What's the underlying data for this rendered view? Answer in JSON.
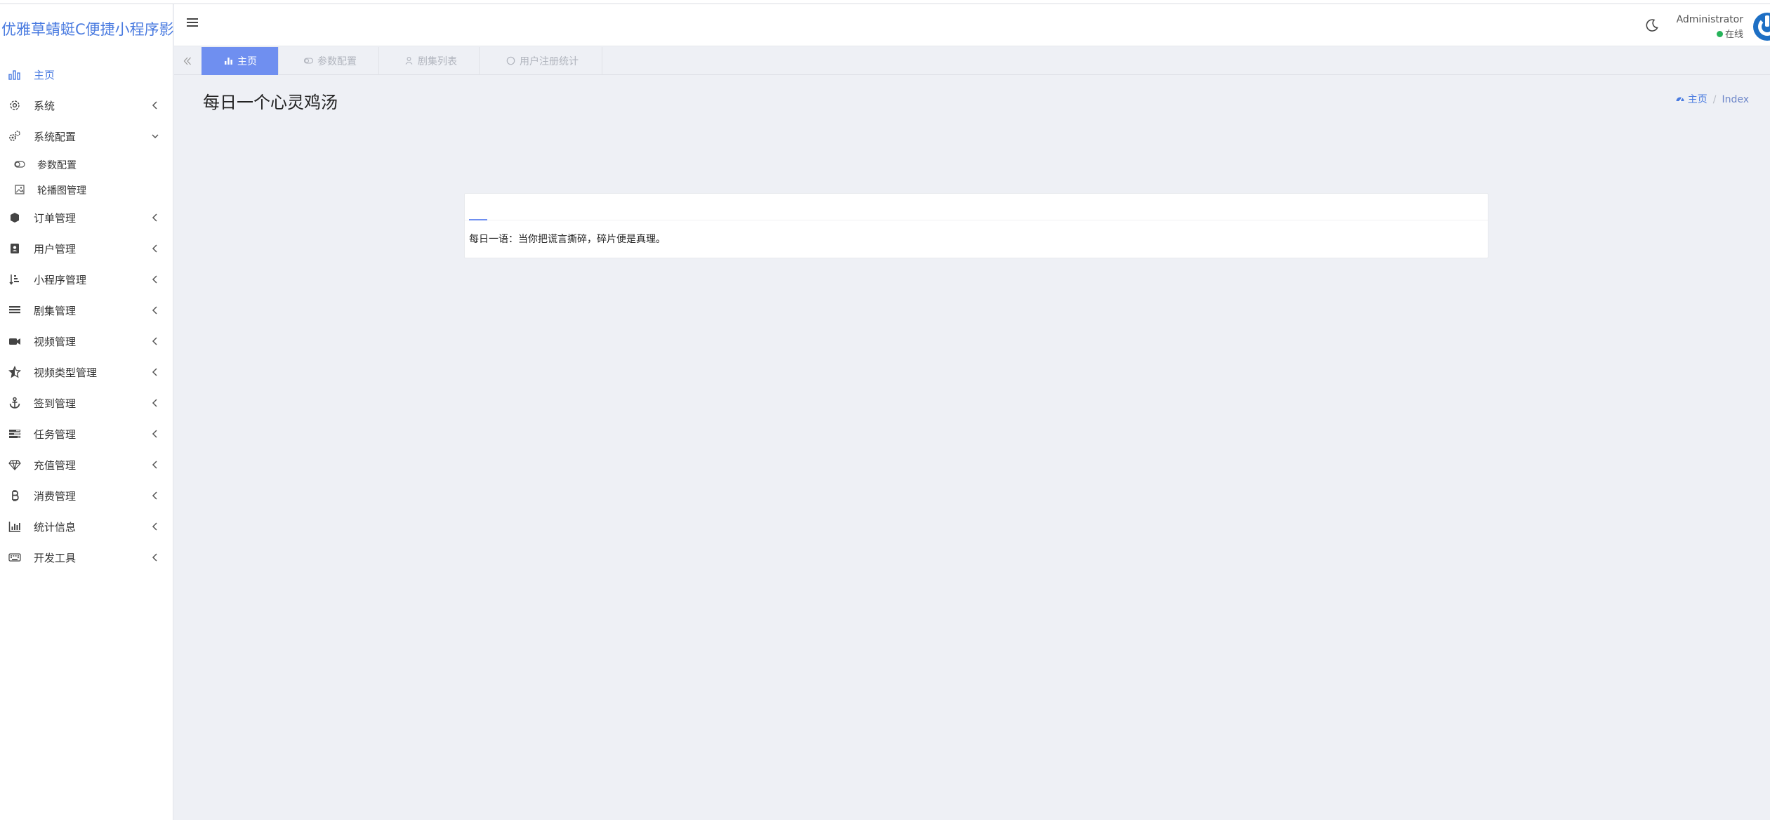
{
  "brand": {
    "title": "优雅草蜻蜓C便捷小程序影视"
  },
  "sidebar": {
    "items": [
      {
        "label": "主页",
        "icon": "bar-chart-icon",
        "active": true,
        "chevron": ""
      },
      {
        "label": "系统",
        "icon": "gear-icon",
        "chevron": "left"
      },
      {
        "label": "系统配置",
        "icon": "gears-icon",
        "chevron": "down",
        "children": [
          {
            "label": "参数配置",
            "icon": "toggle-icon"
          },
          {
            "label": "轮播图管理",
            "icon": "image-icon"
          }
        ]
      },
      {
        "label": "订单管理",
        "icon": "cube-icon",
        "chevron": "left"
      },
      {
        "label": "用户管理",
        "icon": "address-book-icon",
        "chevron": "left"
      },
      {
        "label": "小程序管理",
        "icon": "sort-list-icon",
        "chevron": "left"
      },
      {
        "label": "剧集管理",
        "icon": "list-icon",
        "chevron": "left"
      },
      {
        "label": "视频管理",
        "icon": "video-camera-icon",
        "chevron": "left"
      },
      {
        "label": "视频类型管理",
        "icon": "star-half-icon",
        "chevron": "left"
      },
      {
        "label": "签到管理",
        "icon": "anchor-icon",
        "chevron": "left"
      },
      {
        "label": "任务管理",
        "icon": "tasks-icon",
        "chevron": "left"
      },
      {
        "label": "充值管理",
        "icon": "diamond-icon",
        "chevron": "left"
      },
      {
        "label": "消费管理",
        "icon": "bitcoin-icon",
        "chevron": "left"
      },
      {
        "label": "统计信息",
        "icon": "stats-icon",
        "chevron": "left"
      },
      {
        "label": "开发工具",
        "icon": "keyboard-icon",
        "chevron": "left"
      }
    ]
  },
  "header": {
    "user": {
      "name": "Administrator",
      "status": "在线"
    }
  },
  "tabs": [
    {
      "label": "主页",
      "icon": "bar-chart-icon",
      "active": true
    },
    {
      "label": "参数配置",
      "icon": "toggle-icon",
      "active": false
    },
    {
      "label": "剧集列表",
      "icon": "users-icon",
      "active": false
    },
    {
      "label": "用户注册统计",
      "icon": "circle-icon",
      "active": false
    }
  ],
  "page": {
    "title": "每日一个心灵鸡汤",
    "breadcrumb": {
      "home": "主页",
      "current": "Index"
    },
    "quote": "每日一语：当你把谎言撕碎，碎片便是真理。"
  },
  "colors": {
    "accent": "#4a7be0",
    "tab_active": "#6f8ff0",
    "online": "#26b35a",
    "avatar": "#1d6fc4"
  }
}
